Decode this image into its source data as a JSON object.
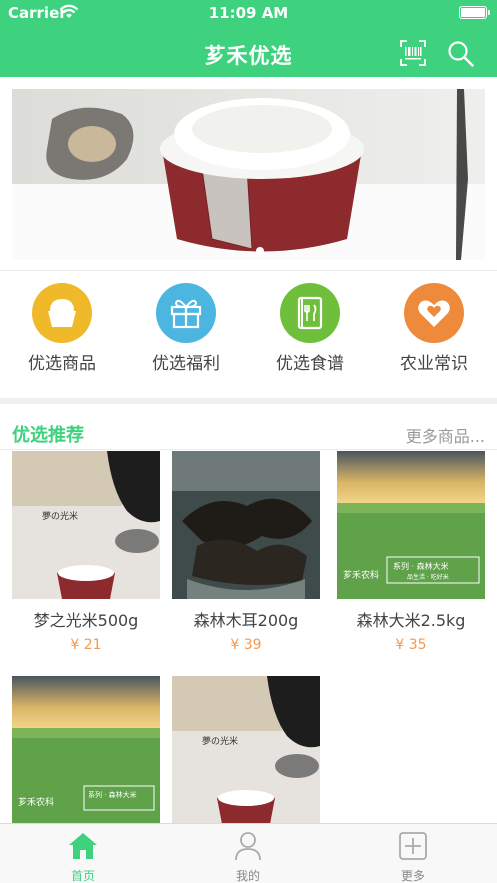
{
  "status_bar": {
    "carrier": "Carrier",
    "time": "11:09 AM"
  },
  "navbar": {
    "title": "芗禾优选"
  },
  "categories": [
    {
      "label": "优选商品",
      "color": "#f0b92a"
    },
    {
      "label": "优选福利",
      "color": "#4cb6e0"
    },
    {
      "label": "优选食谱",
      "color": "#6fbf3c"
    },
    {
      "label": "农业常识",
      "color": "#ee8a3c"
    }
  ],
  "section": {
    "title": "优选推荐",
    "more": "更多商品..."
  },
  "products": [
    {
      "name": "梦之光米500g",
      "price": "¥ 21"
    },
    {
      "name": "森林木耳200g",
      "price": "¥ 39"
    },
    {
      "name": "森林大米2.5kg",
      "price": "¥ 35"
    },
    {
      "name": "",
      "price": ""
    },
    {
      "name": "",
      "price": ""
    }
  ],
  "product_art": {
    "rice_poster_text": "夢の光米",
    "field_brand": "芗禾农科",
    "field_series": "系列 · 森林大米",
    "field_tagline": "品生活 · 吃好米"
  },
  "tabs": [
    {
      "label": "首页",
      "icon": "home-icon",
      "active": true
    },
    {
      "label": "我的",
      "icon": "user-icon",
      "active": false
    },
    {
      "label": "更多",
      "icon": "plus-square-icon",
      "active": false
    }
  ],
  "colors": {
    "brand_green": "#3ed27f",
    "price_orange": "#f39a4e"
  }
}
